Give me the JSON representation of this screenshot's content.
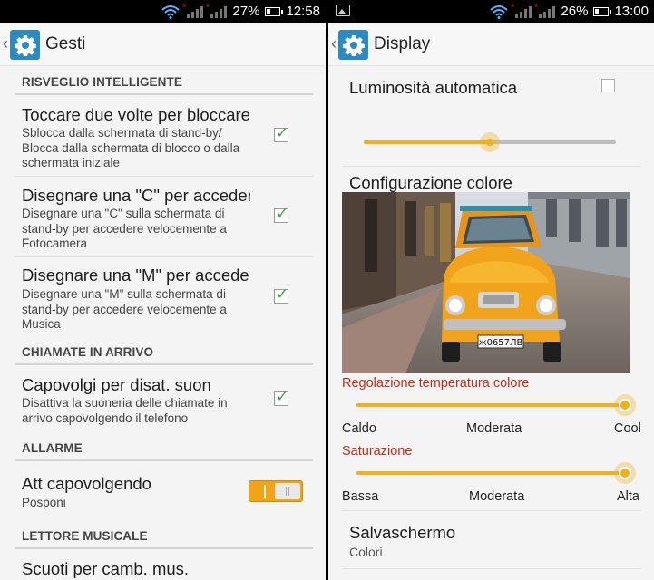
{
  "left": {
    "status": {
      "battery": "27%",
      "time": "12:58"
    },
    "title": "Gesti",
    "sections": {
      "smart_wake": "RISVEGLIO INTELLIGENTE",
      "incoming_calls": "CHIAMATE IN ARRIVO",
      "alarms": "ALLARME",
      "music_player": "LETTORE MUSICALE"
    },
    "items": [
      {
        "title": "Toccare due volte per bloccare/",
        "subtitle": "Sblocca dalla schermata di stand-by/ Blocca dalla schermata di blocco o dalla schermata iniziale",
        "checked": true
      },
      {
        "title": "Disegnare una \"C\" per accedere",
        "subtitle": "Disegnare una \"C\" sulla schermata di stand-by per accedere velocemente a Fotocamera",
        "checked": true
      },
      {
        "title": "Disegnare una \"M\" per accedere",
        "subtitle": "Disegnare una \"M\" sulla schermata di stand-by per accedere velocemente a Musica",
        "checked": true
      },
      {
        "title": "Capovolgi per disat. suon",
        "subtitle": "Disattiva la suoneria delle chiamate in arrivo capovolgendo il telefono",
        "checked": true
      }
    ],
    "alarm_item": {
      "title": "Att capovolgendo",
      "subtitle": "Posponi",
      "toggle_on": true
    },
    "music_item": {
      "title": "Scuoti per camb. mus."
    }
  },
  "right": {
    "status": {
      "battery": "26%",
      "time": "13:00"
    },
    "title": "Display",
    "auto_brightness": {
      "label": "Luminosità automatica",
      "checked": false
    },
    "brightness_level": 0.5,
    "color_config": "Configurazione colore",
    "temperature": {
      "label": "Regolazione temperatura colore",
      "min": "Caldo",
      "mid": "Moderata",
      "max": "Cool",
      "level": 1.0
    },
    "saturation": {
      "label": "Saturazione",
      "min": "Bassa",
      "mid": "Moderata",
      "max": "Alta",
      "level": 1.0
    },
    "screensaver": {
      "title": "Salvaschermo",
      "subtitle": "Colori"
    },
    "plate": "ж0657ЛВ"
  },
  "colors": {
    "accent_blue": "#2a8ac5",
    "accent_orange": "#f0a416",
    "label_red": "#c62b17",
    "check_green": "#3aa63a"
  },
  "icons": [
    "wifi-icon",
    "signal-icon",
    "battery-icon",
    "gear-icon",
    "back-chevron-icon",
    "checkbox-icon",
    "toggle-switch-icon",
    "picture-notification-icon"
  ]
}
